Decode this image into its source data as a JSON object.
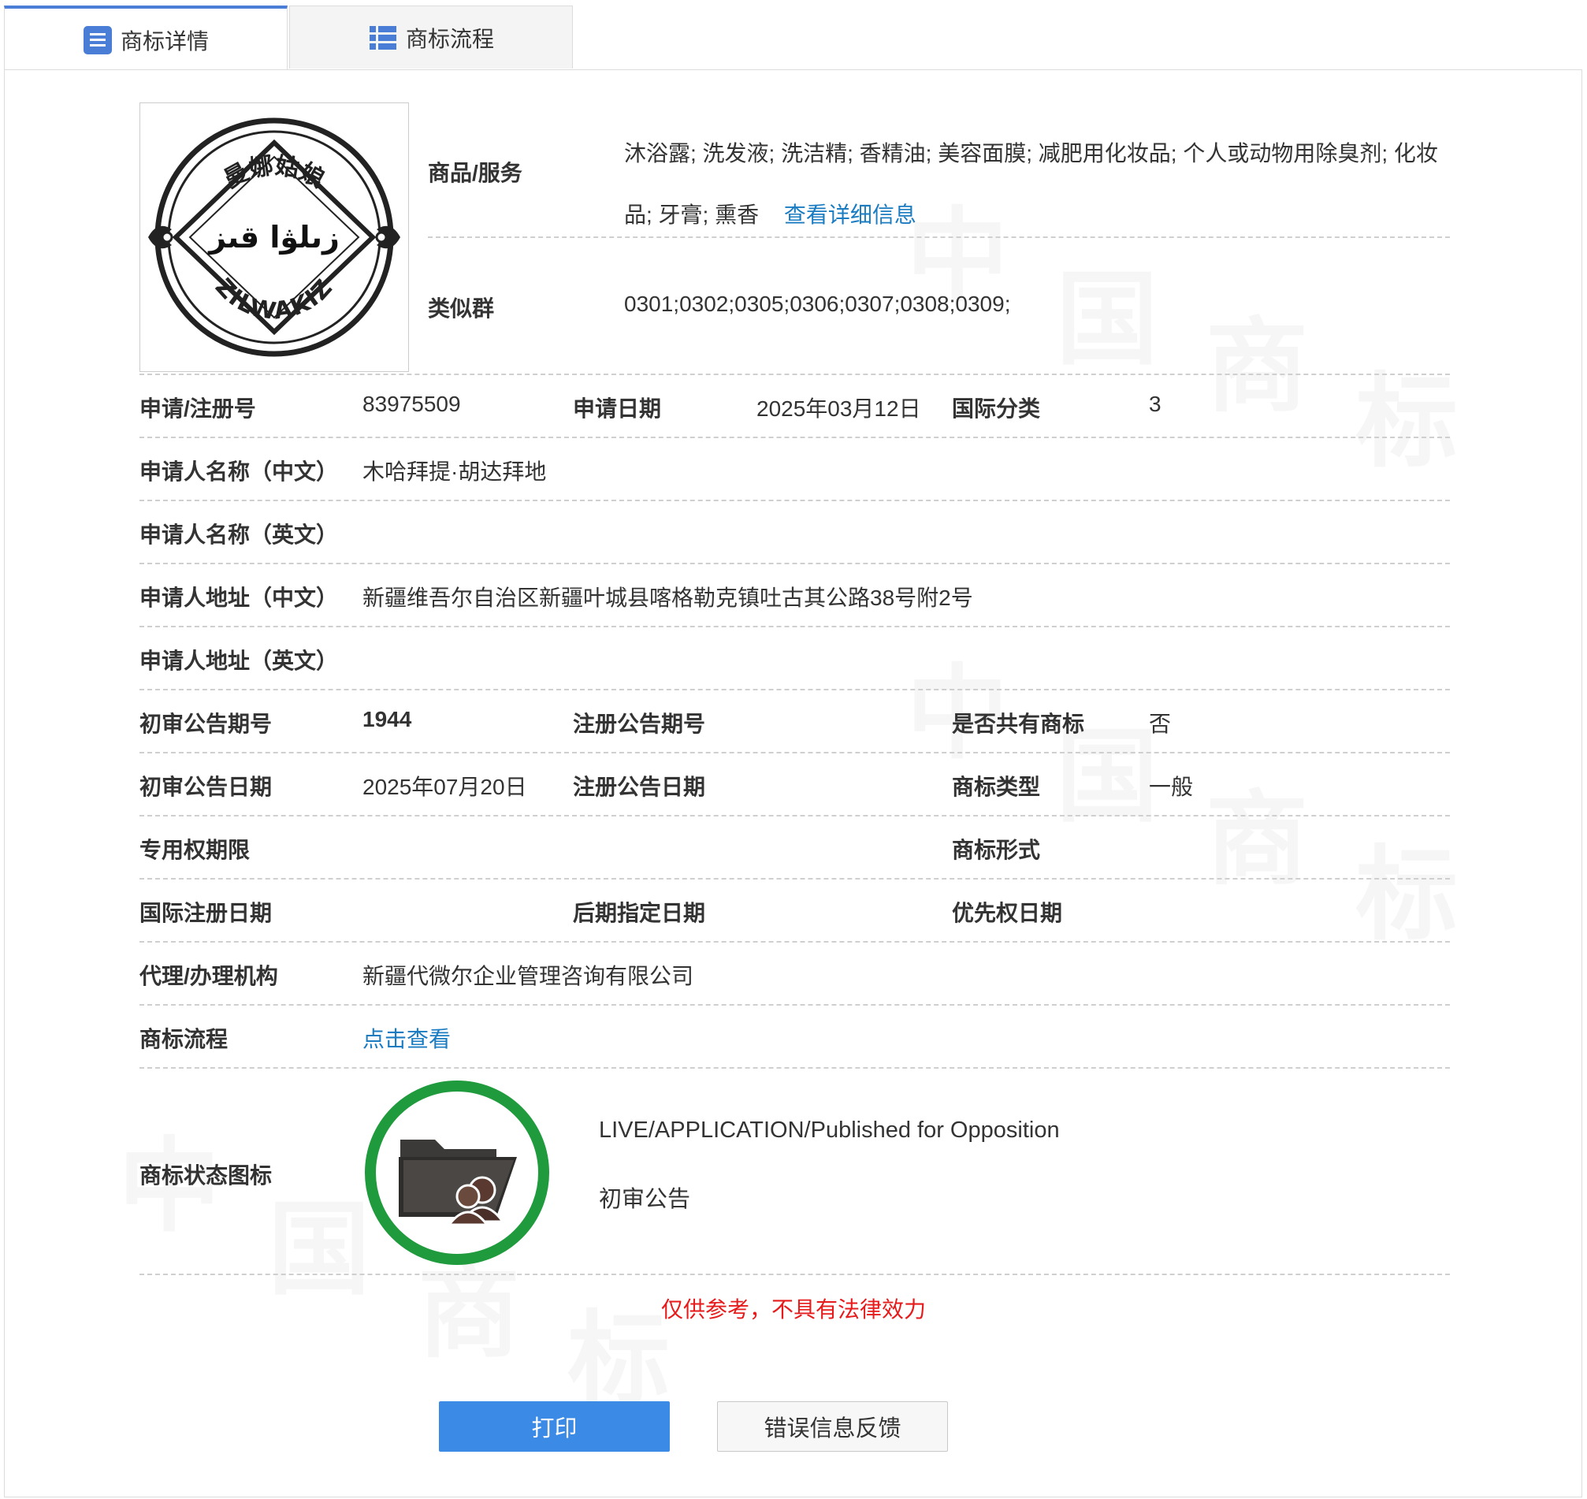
{
  "tabs": [
    {
      "label": "商标详情",
      "icon": "list-doc-icon",
      "active": true
    },
    {
      "label": "商标流程",
      "icon": "list-grid-icon",
      "active": false
    }
  ],
  "logo": {
    "text_top": "曼娜姑娘",
    "text_middle": "زىلۋا قىز",
    "text_bottom": "ZILWAKIZ"
  },
  "goods": {
    "label": "商品/服务",
    "value": "沐浴露; 洗发液; 洗洁精; 香精油; 美容面膜; 减肥用化妆品; 个人或动物用除臭剂; 化妆品; 牙膏; 熏香",
    "detail_link": "查看详细信息"
  },
  "similar": {
    "label": "类似群",
    "value": "0301;0302;0305;0306;0307;0308;0309;"
  },
  "fields": {
    "reg_no_label": "申请/注册号",
    "reg_no": "83975509",
    "app_date_label": "申请日期",
    "app_date": "2025年03月12日",
    "intl_class_label": "国际分类",
    "intl_class": "3",
    "applicant_cn_label": "申请人名称（中文）",
    "applicant_cn": "木哈拜提·胡达拜地",
    "applicant_en_label": "申请人名称（英文）",
    "address_cn_label": "申请人地址（中文）",
    "address_cn": "新疆维吾尔自治区新疆叶城县喀格勒克镇吐古其公路38号附2号",
    "address_en_label": "申请人地址（英文）",
    "prelim_issue_label": "初审公告期号",
    "prelim_issue": "1944",
    "reg_issue_label": "注册公告期号",
    "shared_label": "是否共有商标",
    "shared": "否",
    "prelim_date_label": "初审公告日期",
    "prelim_date": "2025年07月20日",
    "reg_date_label": "注册公告日期",
    "tm_type_label": "商标类型",
    "tm_type": "一般",
    "exclusive_label": "专用权期限",
    "tm_form_label": "商标形式",
    "intl_reg_date_label": "国际注册日期",
    "later_date_label": "后期指定日期",
    "priority_label": "优先权日期",
    "agency_label": "代理/办理机构",
    "agency": "新疆代微尔企业管理咨询有限公司",
    "process_label": "商标流程",
    "process_link": "点击查看",
    "status_icon_label": "商标状态图标"
  },
  "status": {
    "en": "LIVE/APPLICATION/Published for Opposition",
    "cn": "初审公告",
    "ring_color": "#1f9a3c"
  },
  "note": "仅供参考，不具有法律效力",
  "buttons": {
    "print": "打印",
    "feedback": "错误信息反馈"
  },
  "colors": {
    "link": "#1b7cc1",
    "primary": "#3b8ae6",
    "warning": "#e61b1b",
    "tab_active": "#4a7ed6"
  }
}
